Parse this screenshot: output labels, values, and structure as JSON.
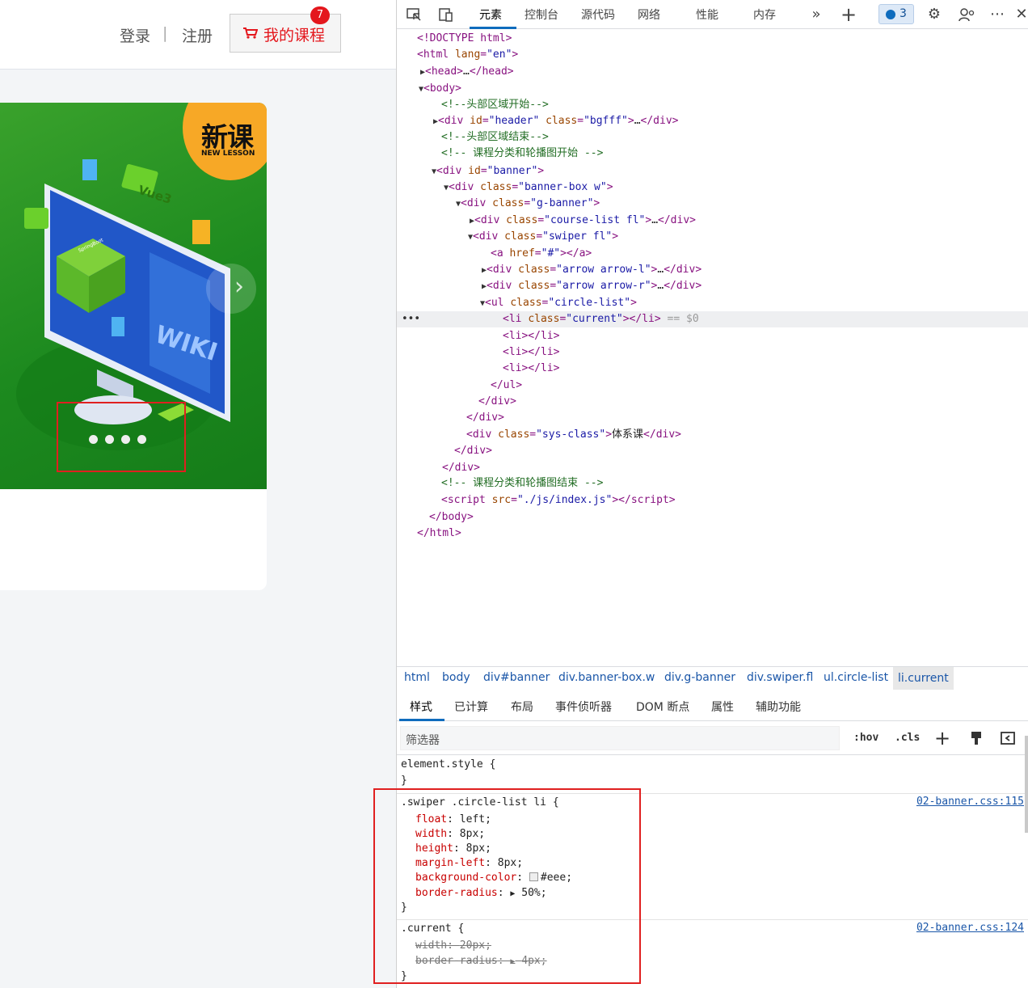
{
  "header": {
    "login": "登录",
    "separator": "|",
    "register": "注册",
    "my_courses": "我的课程",
    "badge_count": "7"
  },
  "banner": {
    "badge_big": "新课",
    "badge_small": "NEW LESSON",
    "arrow_right": "›",
    "dots": 4,
    "image_texts": [
      "Vue3",
      "WIKI",
      "SpringBoot"
    ]
  },
  "devtools": {
    "tabs": [
      "元素",
      "控制台",
      "源代码",
      "网络",
      "性能",
      "内存"
    ],
    "active_tab": "元素",
    "issues_count": "3",
    "dom": [
      {
        "html": "<span class='tag'>&lt;!DOCTYPE html&gt;</span>"
      },
      {
        "html": "<span class='tag'>&lt;html</span> <span class='attr'>lang</span>=<span class='val'>\"en\"</span><span class='tag'>&gt;</span>"
      },
      {
        "html": "<span class='tri'>▶</span><span class='tag'>&lt;head&gt;</span><span class='txt'>…</span><span class='tag'>&lt;/head&gt;</span>"
      },
      {
        "html": "<span class='tri'>▼</span><span class='tag'>&lt;body&gt;</span>"
      },
      {
        "html": "<span class='cmt'>&lt;!--头部区域开始--&gt;</span>"
      },
      {
        "html": "<span class='tri'>▶</span><span class='tag'>&lt;div</span> <span class='attr'>id</span>=<span class='val'>\"header\"</span> <span class='attr'>class</span>=<span class='val'>\"bgfff\"</span><span class='tag'>&gt;</span><span class='txt'>…</span><span class='tag'>&lt;/div&gt;</span>"
      },
      {
        "html": "<span class='cmt'>&lt;!--头部区域结束--&gt;</span>"
      },
      {
        "html": "<span class='cmt'>&lt;!-- 课程分类和轮播图开始 --&gt;</span>"
      },
      {
        "html": "<span class='tri'>▼</span><span class='tag'>&lt;div</span> <span class='attr'>id</span>=<span class='val'>\"banner\"</span><span class='tag'>&gt;</span>"
      },
      {
        "html": "<span class='tri'>▼</span><span class='tag'>&lt;div</span> <span class='attr'>class</span>=<span class='val'>\"banner-box w\"</span><span class='tag'>&gt;</span>"
      },
      {
        "html": "<span class='tri'>▼</span><span class='tag'>&lt;div</span> <span class='attr'>class</span>=<span class='val'>\"g-banner\"</span><span class='tag'>&gt;</span>"
      },
      {
        "html": "<span class='tri'>▶</span><span class='tag'>&lt;div</span> <span class='attr'>class</span>=<span class='val'>\"course-list fl\"</span><span class='tag'>&gt;</span><span class='txt'>…</span><span class='tag'>&lt;/div&gt;</span>"
      },
      {
        "html": "<span class='tri'>▼</span><span class='tag'>&lt;div</span> <span class='attr'>class</span>=<span class='val'>\"swiper fl\"</span><span class='tag'>&gt;</span>"
      },
      {
        "html": "<span class='tag'>&lt;a</span> <span class='attr'>href</span>=<span class='val'>\"#\"</span><span class='tag'>&gt;&lt;/a&gt;</span>"
      },
      {
        "html": "<span class='tri'>▶</span><span class='tag'>&lt;div</span> <span class='attr'>class</span>=<span class='val'>\"arrow arrow-l\"</span><span class='tag'>&gt;</span><span class='txt'>…</span><span class='tag'>&lt;/div&gt;</span>"
      },
      {
        "html": "<span class='tri'>▶</span><span class='tag'>&lt;div</span> <span class='attr'>class</span>=<span class='val'>\"arrow arrow-r\"</span><span class='tag'>&gt;</span><span class='txt'>…</span><span class='tag'>&lt;/div&gt;</span>"
      },
      {
        "html": "<span class='tri'>▼</span><span class='tag'>&lt;ul</span> <span class='attr'>class</span>=<span class='val'>\"circle-list\"</span><span class='tag'>&gt;</span>"
      },
      {
        "html": "<span class='tag'>&lt;li</span> <span class='attr'>class</span>=<span class='val'>\"current\"</span><span class='tag'>&gt;&lt;/li&gt;</span> <span class='dimmed'>== $0</span>",
        "selected": true
      },
      {
        "html": "<span class='tag'>&lt;li&gt;&lt;/li&gt;</span>"
      },
      {
        "html": "<span class='tag'>&lt;li&gt;&lt;/li&gt;</span>"
      },
      {
        "html": "<span class='tag'>&lt;li&gt;&lt;/li&gt;</span>"
      },
      {
        "html": "<span class='tag'>&lt;/ul&gt;</span>"
      },
      {
        "html": "<span class='tag'>&lt;/div&gt;</span>"
      },
      {
        "html": "<span class='tag'>&lt;/div&gt;</span>"
      },
      {
        "html": "<span class='tag'>&lt;div</span> <span class='attr'>class</span>=<span class='val'>\"sys-class\"</span><span class='tag'>&gt;</span><span class='txt'>体系课</span><span class='tag'>&lt;/div&gt;</span>"
      },
      {
        "html": "<span class='tag'>&lt;/div&gt;</span>"
      },
      {
        "html": "<span class='tag'>&lt;/div&gt;</span>"
      },
      {
        "html": "<span class='cmt'>&lt;!-- 课程分类和轮播图结束 --&gt;</span>"
      },
      {
        "html": "<span class='tag'>&lt;script</span> <span class='attr'>src</span>=<span class='val'>\"./js/index.js\"</span><span class='tag'>&gt;&lt;/script&gt;</span>"
      },
      {
        "html": "<span class='tag'>&lt;/body&gt;</span>"
      },
      {
        "html": "<span class='tag'>&lt;/html&gt;</span>"
      }
    ],
    "breadcrumbs": [
      "html",
      "body",
      "div#banner",
      "div.banner-box.w",
      "div.g-banner",
      "div.swiper.fl",
      "ul.circle-list",
      "li.current"
    ],
    "style_tabs": [
      "样式",
      "已计算",
      "布局",
      "事件侦听器",
      "DOM 断点",
      "属性",
      "辅助功能"
    ],
    "filter_placeholder": "筛选器",
    "filter_buttons": [
      ":hov",
      ".cls"
    ],
    "element_style": "element.style {",
    "rule1": {
      "selector": ".swiper .circle-list li {",
      "source": "02-banner.css:115",
      "props": [
        {
          "name": "float",
          "value": "left;"
        },
        {
          "name": "width",
          "value": "8px;"
        },
        {
          "name": "height",
          "value": "8px;"
        },
        {
          "name": "margin-left",
          "value": "8px;"
        },
        {
          "name": "background-color",
          "value": "#eee;"
        },
        {
          "name": "border-radius",
          "value": "50%;"
        }
      ]
    },
    "rule2": {
      "selector": ".current {",
      "source": "02-banner.css:124",
      "props": [
        {
          "name": "width",
          "value": "20px;"
        },
        {
          "name": "border-radius",
          "value": "4px;"
        }
      ]
    }
  }
}
